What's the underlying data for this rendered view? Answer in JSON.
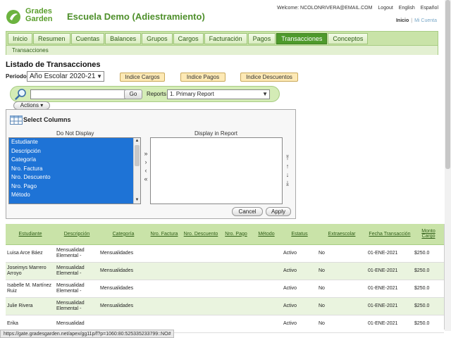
{
  "brand": {
    "logo_text_line1": "Grades",
    "logo_text_line2": "Garden",
    "school_name": "Escuela Demo (Adiestramiento)"
  },
  "topbar": {
    "welcome": "Welcome: NCOLONRIVERA@EMAIL.COM",
    "logout": "Logout",
    "english": "English",
    "espanol": "Español",
    "inicio": "Inicio",
    "separator": "|",
    "mi_cuenta": "Mi Cuenta"
  },
  "nav": {
    "tabs": [
      "Inicio",
      "Resumen",
      "Cuentas",
      "Balances",
      "Grupos",
      "Cargos",
      "Facturación",
      "Pagos",
      "Transacciones",
      "Conceptos"
    ],
    "active": "Transacciones",
    "subnav": "Transacciones"
  },
  "page": {
    "title": "Listado de Transacciones",
    "periodo_label": "Periodo",
    "periodo_value": "Año Escolar 2020-21"
  },
  "index_buttons": {
    "cargos": "Indice Cargos",
    "pagos": "Indice Pagos",
    "descuentos": "Indice Descuentos"
  },
  "search": {
    "value": "",
    "go": "Go",
    "reports_label": "Reports",
    "report_selected": "1. Primary Report",
    "actions": "Actions"
  },
  "columns_panel": {
    "title": "Select Columns",
    "left_header": "Do Not Display",
    "right_header": "Display in Report",
    "left_items": [
      "Estudiante",
      "Descripción",
      "Categoría",
      "Nro. Factura",
      "Nro. Descuento",
      "Nro. Pago",
      "Método"
    ],
    "cancel": "Cancel",
    "apply": "Apply"
  },
  "table": {
    "headers": [
      "Estudiante",
      "Descripción",
      "Categoría",
      "Nro. Factura",
      "Nro. Descuento",
      "Nro. Pago",
      "Método",
      "Estatus",
      "Extraescolar",
      "Fecha Transacción",
      "Monto Cargo"
    ],
    "rows": [
      {
        "estudiante": "Luisa Arce Báez",
        "descripcion": "Mensualidad Elemental -",
        "categoria": "Mensualidades",
        "estatus": "Activo",
        "extra": "No",
        "fecha": "01-ENE-2021",
        "monto": "$250.0"
      },
      {
        "estudiante": "Joseimys Marrero Arroyo",
        "descripcion": "Mensualidad Elemental -",
        "categoria": "Mensualidades",
        "estatus": "Activo",
        "extra": "No",
        "fecha": "01-ENE-2021",
        "monto": "$250.0"
      },
      {
        "estudiante": "Isabelle M. Martínez Ruiz",
        "descripcion": "Mensualidad Elemental -",
        "categoria": "Mensualidades",
        "estatus": "Activo",
        "extra": "No",
        "fecha": "01-ENE-2021",
        "monto": "$250.0"
      },
      {
        "estudiante": "Julie Rivera",
        "descripcion": "Mensualidad Elemental -",
        "categoria": "Mensualidades",
        "estatus": "Activo",
        "extra": "No",
        "fecha": "01-ENE-2021",
        "monto": "$250.0"
      },
      {
        "estudiante": "Erika",
        "descripcion": "Mensualidad",
        "categoria": "",
        "estatus": "Activo",
        "extra": "No",
        "fecha": "01-ENE-2021",
        "monto": "$250.0"
      }
    ]
  },
  "status_url": "https://gate.gradesgarden.net/apex/gg11p/f?p=1060:80:525335233799::NO#",
  "colors": {
    "brand_green": "#4e9a2c",
    "nav_bg": "#c9e3a8",
    "selection_blue": "#1e73d6",
    "index_button": "#fde9b5"
  }
}
